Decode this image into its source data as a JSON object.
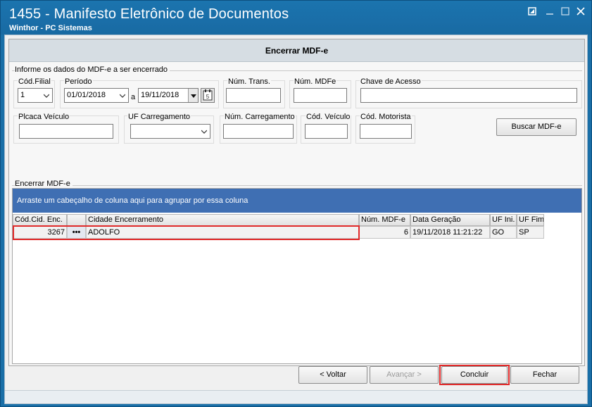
{
  "window": {
    "title": "1455 - Manifesto Eletrônico de Documentos",
    "subtitle": "Winthor - PC Sistemas",
    "buttons": {
      "restore": "▪",
      "minimize": "—",
      "maximize": "□",
      "close": "✕"
    }
  },
  "panel": {
    "header": "Encerrar MDF-e",
    "section_label": "Informe os dados do MDF-e a ser encerrado",
    "fields": {
      "cod_filial": {
        "label": "Cód.Filial",
        "value": "1"
      },
      "periodo": {
        "label": "Período",
        "start": "01/01/2018",
        "separator": "a",
        "end": "19/11/2018"
      },
      "num_trans": {
        "label": "Núm. Trans.",
        "value": ""
      },
      "num_mdfe": {
        "label": "Núm. MDFe",
        "value": ""
      },
      "chave_acesso": {
        "label": "Chave de Acesso",
        "value": ""
      },
      "placa_veiculo": {
        "label": "Plcaca Veículo",
        "value": ""
      },
      "uf_carregamento": {
        "label": "UF Carregamento",
        "value": ""
      },
      "num_carregamento": {
        "label": "Núm. Carregamento",
        "value": ""
      },
      "cod_veiculo": {
        "label": "Cód. Veículo",
        "value": ""
      },
      "cod_motorista": {
        "label": "Cód. Motorista",
        "value": ""
      }
    },
    "search_button": "Buscar MDF-e"
  },
  "grid": {
    "section_label": "Encerrar MDF-e",
    "group_hint": "Arraste um cabeçalho de coluna aqui para agrupar por essa coluna",
    "columns": [
      "Cód.Cid. Enc.",
      "",
      "Cidade Encerramento",
      "Núm. MDF-e",
      "Data Geração",
      "UF Ini.",
      "UF Fim"
    ],
    "rows": [
      {
        "cod_cid_enc": "3267",
        "ellipsis": "•••",
        "cidade": "ADOLFO",
        "num_mdfe": "6",
        "data_geracao": "19/11/2018 11:21:22",
        "uf_ini": "GO",
        "uf_fim": "SP"
      }
    ]
  },
  "footer": {
    "voltar": "< Voltar",
    "avancar": "Avançar >",
    "concluir": "Concluir",
    "fechar": "Fechar"
  },
  "colors": {
    "titlebar": "#1a6fa7",
    "groupbar": "#3f6fb3",
    "highlight": "#e02a2a"
  }
}
